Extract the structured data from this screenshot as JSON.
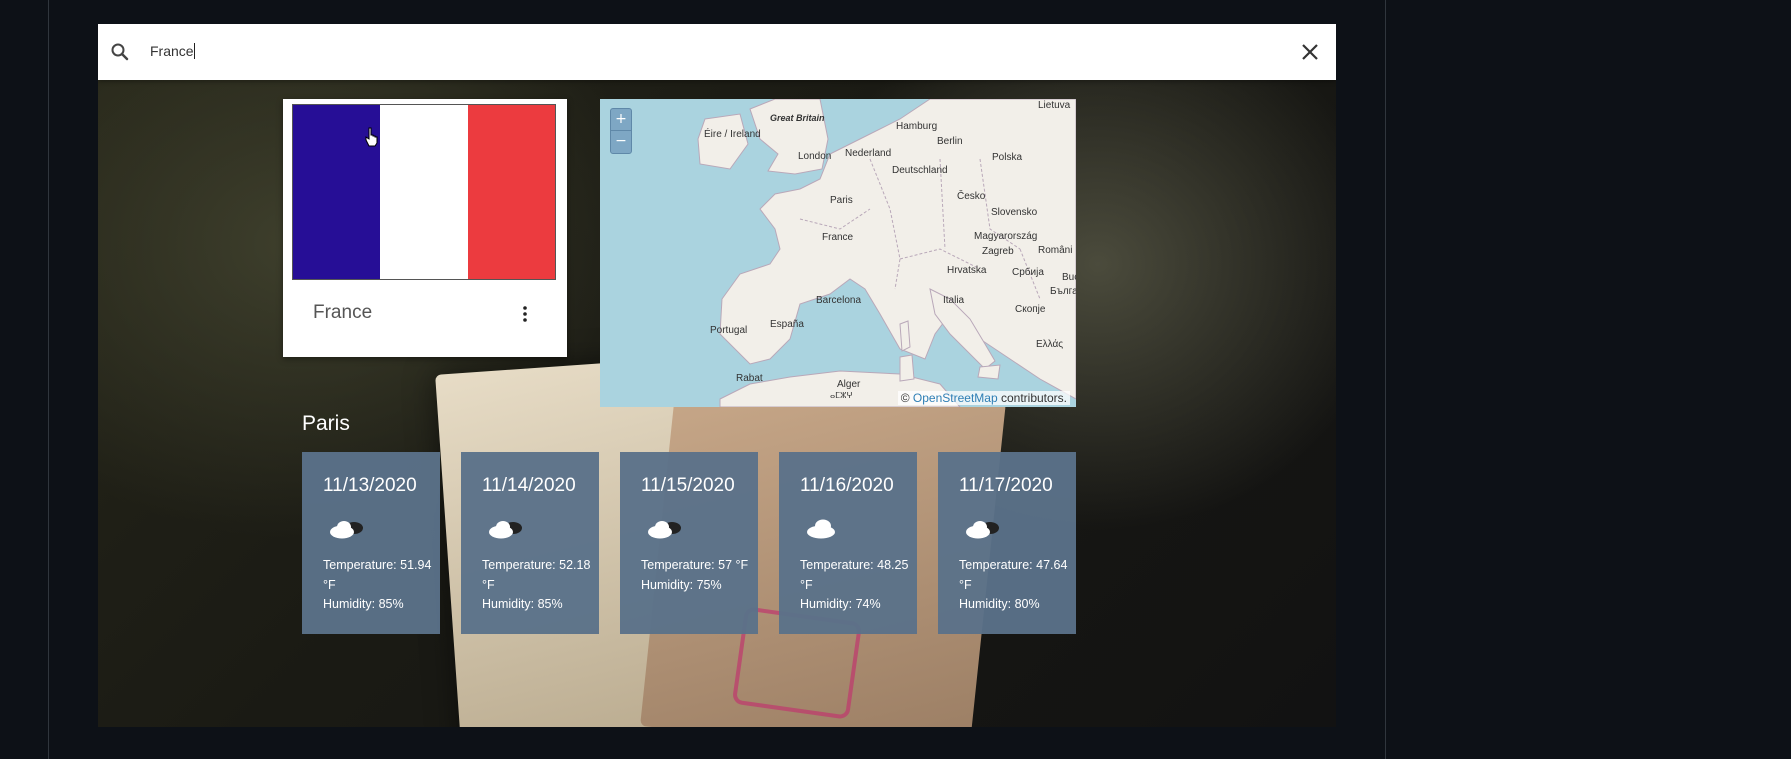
{
  "search": {
    "value": "France",
    "search_icon": "search-icon",
    "clear_icon": "close-icon"
  },
  "country": {
    "name": "France",
    "flag_colors": [
      "#260e96",
      "#ffffff",
      "#ec3b3f"
    ],
    "menu_icon": "more-vert-icon"
  },
  "map": {
    "zoom_in": "+",
    "zoom_out": "−",
    "attribution_prefix": "©",
    "attribution_link": "OpenStreetMap",
    "attribution_suffix": "contributors.",
    "labels": {
      "great_britain": "Great Britain",
      "eire": "Éire / Ireland",
      "london": "London",
      "nederland": "Nederland",
      "hamburg": "Hamburg",
      "berlin": "Berlin",
      "deutschland": "Deutschland",
      "polska": "Polska",
      "lietuva": "Lietuva",
      "paris": "Paris",
      "cesko": "Česko",
      "slovensko": "Slovensko",
      "france": "France",
      "magyarorszag": "Magyarország",
      "zagreb": "Zagreb",
      "romania": "Români",
      "hrvatska": "Hrvatska",
      "srbija": "Србија",
      "buc": "Buc",
      "balgaria": "Бълга",
      "barcelona": "Barcelona",
      "italia": "Italia",
      "skopje": "Скопје",
      "portugal": "Portugal",
      "espana": "España",
      "ellas": "Ελλάς",
      "rabat": "Rabat",
      "alger": "Alger",
      "amazigh": "ⴰⵎⵣⵖ"
    }
  },
  "weather": {
    "city": "Paris",
    "days": [
      {
        "date": "11/13/2020",
        "icon": "partly-cloudy-icon",
        "temp": "Temperature: 51.94 °F",
        "humidity": "Humidity: 85%"
      },
      {
        "date": "11/14/2020",
        "icon": "partly-cloudy-icon",
        "temp": "Temperature: 52.18 °F",
        "humidity": "Humidity: 85%"
      },
      {
        "date": "11/15/2020",
        "icon": "partly-cloudy-icon",
        "temp": "Temperature: 57 °F",
        "humidity": "Humidity: 75%"
      },
      {
        "date": "11/16/2020",
        "icon": "cloud-icon",
        "temp": "Temperature: 48.25 °F",
        "humidity": "Humidity: 74%"
      },
      {
        "date": "11/17/2020",
        "icon": "partly-cloudy-icon",
        "temp": "Temperature: 47.64 °F",
        "humidity": "Humidity: 80%"
      }
    ]
  }
}
